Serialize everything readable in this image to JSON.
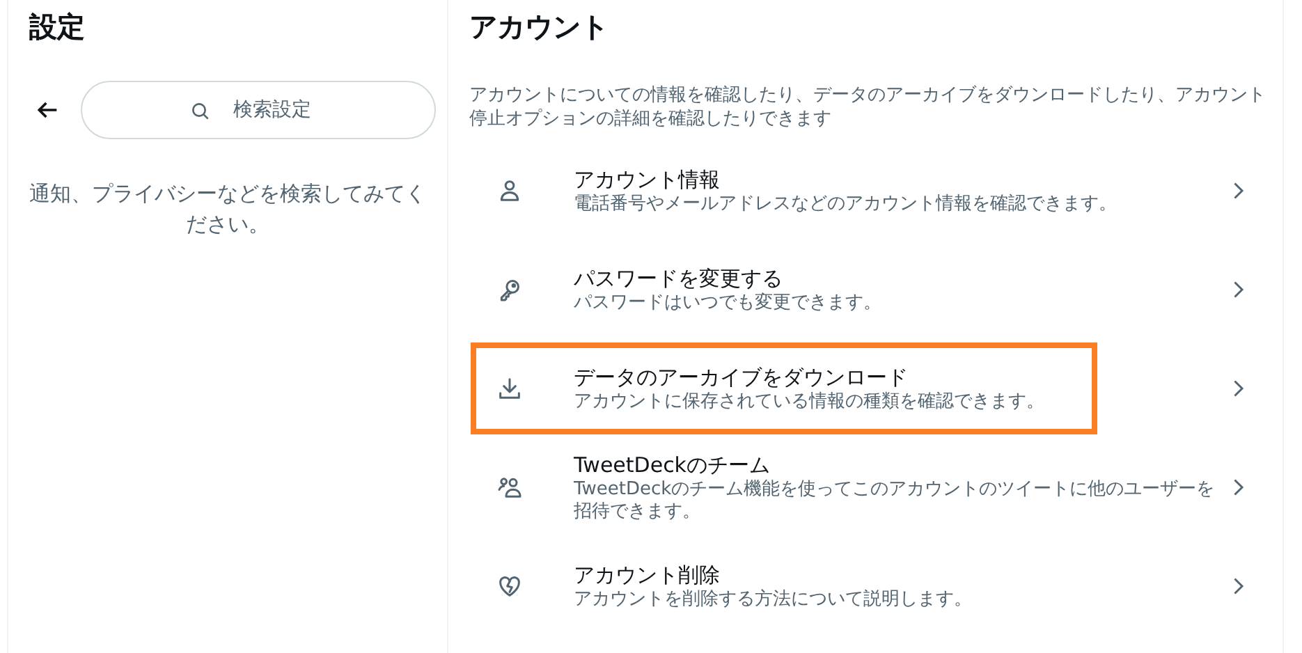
{
  "sidebar": {
    "title": "設定",
    "search": {
      "placeholder": "検索設定"
    },
    "hint": "通知、プライバシーなどを検索してみてください。"
  },
  "main": {
    "title": "アカウント",
    "description": "アカウントについての情報を確認したり、データのアーカイブをダウンロードしたり、アカウント停止オプションの詳細を確認したりできます",
    "items": [
      {
        "kind": "person",
        "title": "アカウント情報",
        "subtitle": "電話番号やメールアドレスなどのアカウント情報を確認できます。",
        "highlighted": false
      },
      {
        "kind": "key",
        "title": "パスワードを変更する",
        "subtitle": "パスワードはいつでも変更できます。",
        "highlighted": false
      },
      {
        "kind": "download",
        "title": "データのアーカイブをダウンロード",
        "subtitle": "アカウントに保存されている情報の種類を確認できます。",
        "highlighted": true
      },
      {
        "kind": "people",
        "title": "TweetDeckのチーム",
        "subtitle": "TweetDeckのチーム機能を使ってこのアカウントのツイートに他のユーザーを招待できます。",
        "highlighted": false
      },
      {
        "kind": "heart",
        "title": "アカウント削除",
        "subtitle": "アカウントを削除する方法について説明します。",
        "highlighted": false
      }
    ]
  }
}
